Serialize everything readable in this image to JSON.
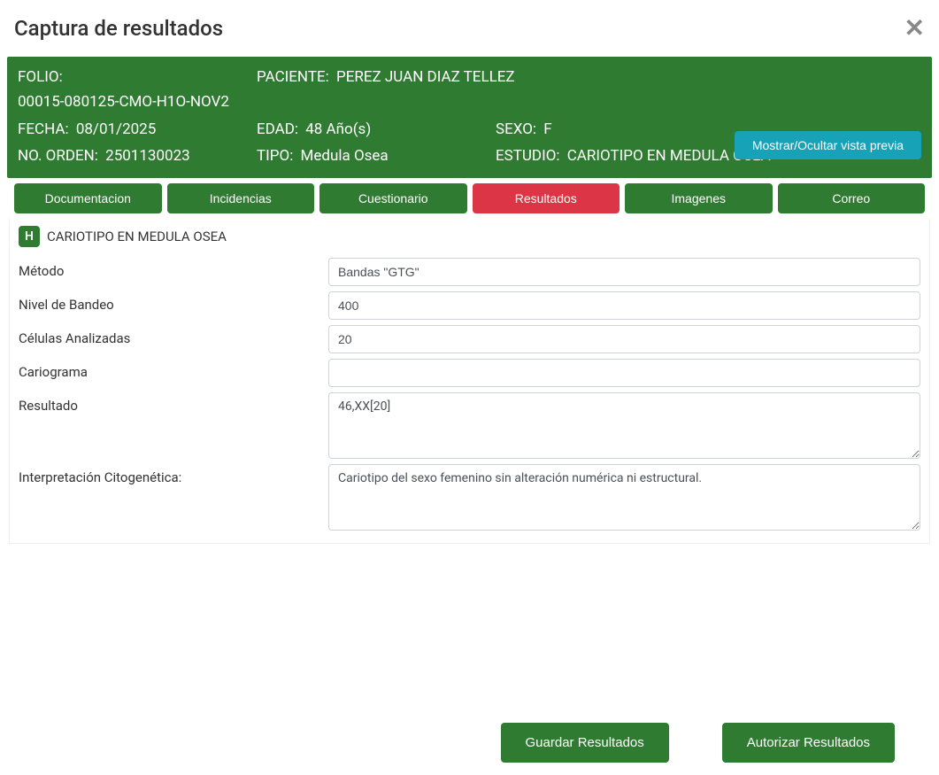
{
  "modal": {
    "title": "Captura de resultados"
  },
  "info": {
    "folio_label": "FOLIO:",
    "folio_value": "00015-080125-CMO-H1O-NOV2",
    "paciente_label": "PACIENTE:",
    "paciente_value": "PEREZ JUAN DIAZ TELLEZ",
    "fecha_label": "FECHA:",
    "fecha_value": "08/01/2025",
    "edad_label": "EDAD:",
    "edad_value": "48 Año(s)",
    "sexo_label": "SEXO:",
    "sexo_value": "F",
    "orden_label": "NO. ORDEN:",
    "orden_value": "2501130023",
    "tipo_label": "TIPO:",
    "tipo_value": "Medula Osea",
    "estudio_label": "ESTUDIO:",
    "estudio_value": "CARIOTIPO EN MEDULA OSEA",
    "preview_btn": "Mostrar/Ocultar vista previa"
  },
  "tabs": {
    "documentacion": "Documentacion",
    "incidencias": "Incidencias",
    "cuestionario": "Cuestionario",
    "resultados": "Resultados",
    "imagenes": "Imagenes",
    "correo": "Correo"
  },
  "section": {
    "badge": "H",
    "name": "CARIOTIPO EN MEDULA OSEA"
  },
  "fields": {
    "metodo_label": "Método",
    "metodo_value": "Bandas \"GTG\"",
    "nivel_label": "Nivel de Bandeo",
    "nivel_value": "400",
    "celulas_label": "Células Analizadas",
    "celulas_value": "20",
    "cariograma_label": "Cariograma",
    "cariograma_value": "",
    "resultado_label": "Resultado",
    "resultado_value": "46,XX[20]",
    "interpretacion_label": "Interpretación Citogenética:",
    "interpretacion_value": "Cariotipo del sexo femenino sin alteración numérica ni estructural."
  },
  "footer": {
    "guardar": "Guardar Resultados",
    "autorizar": "Autorizar Resultados"
  }
}
